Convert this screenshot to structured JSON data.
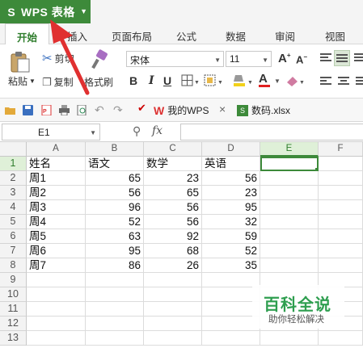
{
  "app": {
    "name": "WPS 表格",
    "logo": "S",
    "accent": "#3d8a3a"
  },
  "ribbon_tabs": [
    "开始",
    "插入",
    "页面布局",
    "公式",
    "数据",
    "审阅",
    "视图"
  ],
  "ribbon": {
    "paste": "粘贴",
    "cut": "剪切",
    "copy": "复制",
    "format_painter": "格式刷",
    "font_name": "宋体",
    "font_size": "11",
    "bold": "B",
    "italic": "I",
    "underline": "U",
    "grow_font": "A",
    "shrink_font": "A",
    "font_color_letter": "A"
  },
  "quick_access": {
    "tabs": [
      {
        "label": "我的WPS",
        "icon": "wps-logo-icon"
      },
      {
        "label": "数码.xlsx",
        "icon": "spreadsheet-file-icon"
      }
    ],
    "close": "×"
  },
  "formula_bar": {
    "cell_ref": "E1",
    "fx": "fx",
    "value": ""
  },
  "sheet": {
    "columns": [
      "A",
      "B",
      "C",
      "D",
      "E",
      "F"
    ],
    "selected_column": "E",
    "selected_row": "1",
    "row_numbers": [
      "1",
      "2",
      "3",
      "4",
      "5",
      "6",
      "7",
      "8",
      "9",
      "10",
      "11",
      "12",
      "13"
    ],
    "rows": [
      [
        "姓名",
        "语文",
        "数学",
        "英语"
      ],
      [
        "周1",
        "65",
        "23",
        "56"
      ],
      [
        "周2",
        "56",
        "65",
        "23"
      ],
      [
        "周3",
        "96",
        "56",
        "95"
      ],
      [
        "周4",
        "52",
        "56",
        "32"
      ],
      [
        "周5",
        "63",
        "92",
        "59"
      ],
      [
        "周6",
        "95",
        "68",
        "52"
      ],
      [
        "周7",
        "86",
        "26",
        "35"
      ]
    ]
  },
  "watermark": {
    "title": "百科全说",
    "subtitle": "助你轻松解决"
  }
}
